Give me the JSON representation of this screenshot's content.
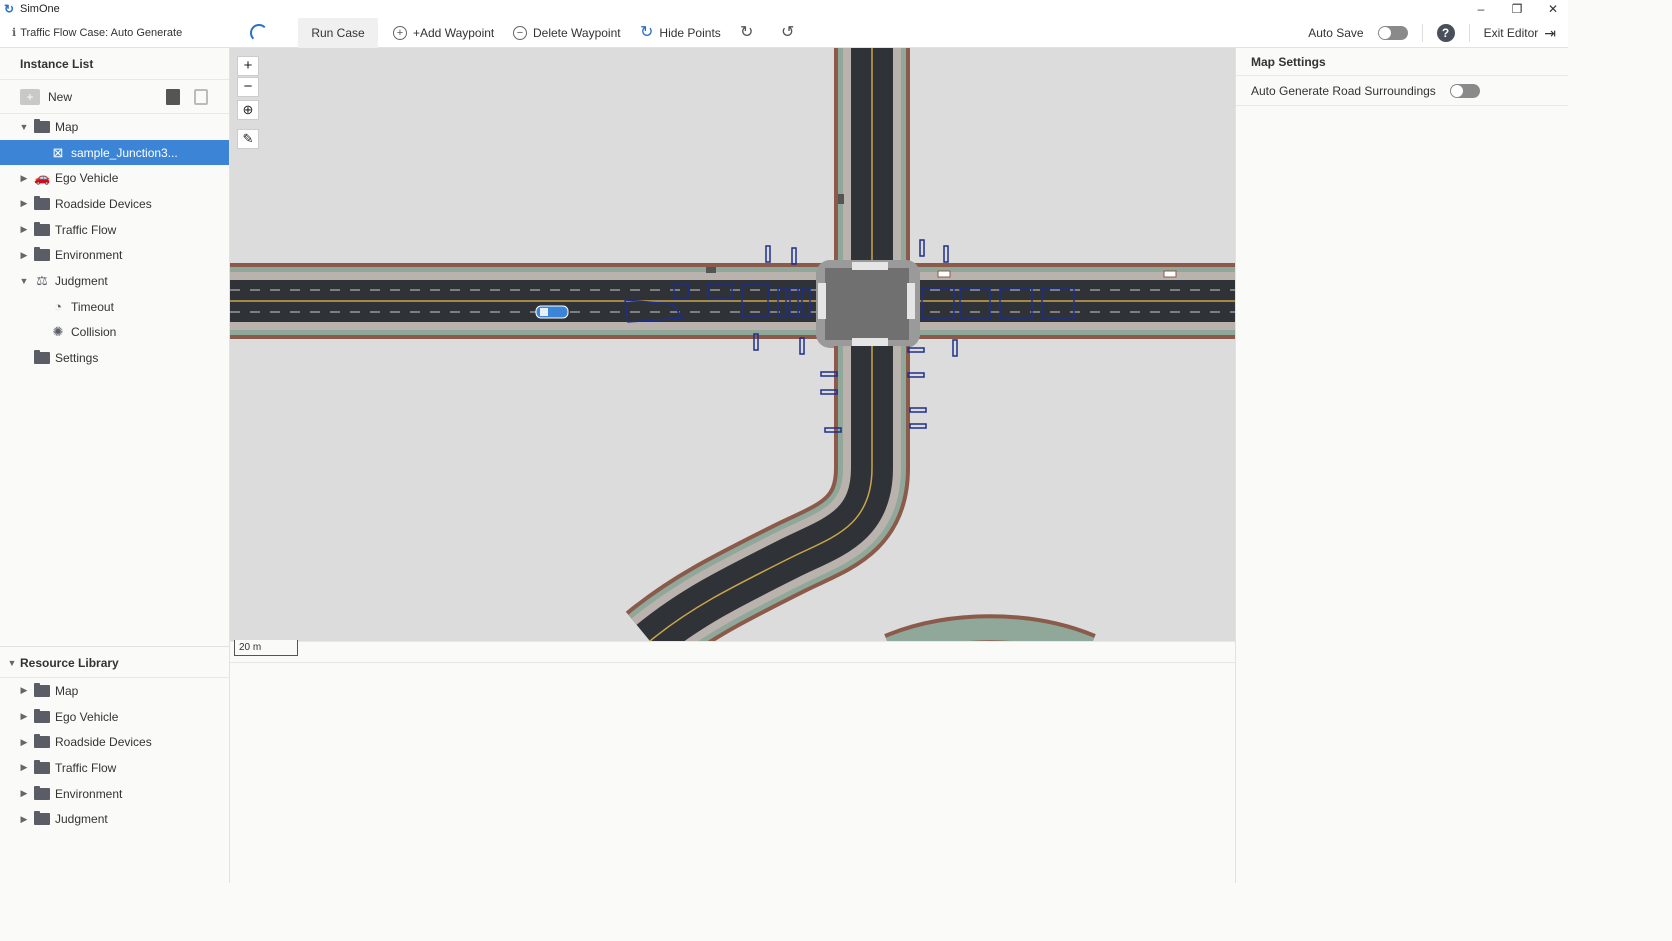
{
  "window": {
    "app_name": "SimOne",
    "minimize": "–",
    "restore": "❐",
    "close": "✕"
  },
  "toolbar": {
    "case_title": "Traffic Flow Case: Auto Generate",
    "run_case": "Run Case",
    "add_waypoint": "+Add Waypoint",
    "delete_waypoint": "Delete Waypoint",
    "hide_points": "Hide Points",
    "auto_save": "Auto Save",
    "help": "?",
    "exit_editor": "Exit Editor"
  },
  "instance_list": {
    "title": "Instance List",
    "new_label": "New",
    "items": [
      {
        "label": "Map",
        "icon": "folder-open-icon",
        "level": 0,
        "expanded": true
      },
      {
        "label": "sample_Junction3...",
        "icon": "map-file-icon",
        "level": 1,
        "selected": true
      },
      {
        "label": "Ego Vehicle",
        "icon": "car-icon",
        "level": 0
      },
      {
        "label": "Roadside Devices",
        "icon": "folder-icon",
        "level": 0
      },
      {
        "label": "Traffic Flow",
        "icon": "folder-icon",
        "level": 0
      },
      {
        "label": "Environment",
        "icon": "folder-icon",
        "level": 0
      },
      {
        "label": "Judgment",
        "icon": "scale-icon",
        "level": 0,
        "expanded": true
      },
      {
        "label": "Timeout",
        "icon": "clock-icon",
        "level": 1
      },
      {
        "label": "Collision",
        "icon": "collision-icon",
        "level": 1
      },
      {
        "label": "Settings",
        "icon": "folder-icon",
        "level": 0
      }
    ]
  },
  "resource_library": {
    "title": "Resource Library",
    "items": [
      "Map",
      "Ego Vehicle",
      "Roadside Devices",
      "Traffic Flow",
      "Environment",
      "Judgment"
    ]
  },
  "map": {
    "zoom_in": "+",
    "zoom_out": "−",
    "scale_label": "20 m"
  },
  "map_settings": {
    "title": "Map Settings",
    "auto_generate_label": "Auto Generate Road Surroundings"
  },
  "colors": {
    "accent": "#3c85d6",
    "road": "#2f3236",
    "curb": "#8b5a4a",
    "verge": "#8fa89a"
  }
}
